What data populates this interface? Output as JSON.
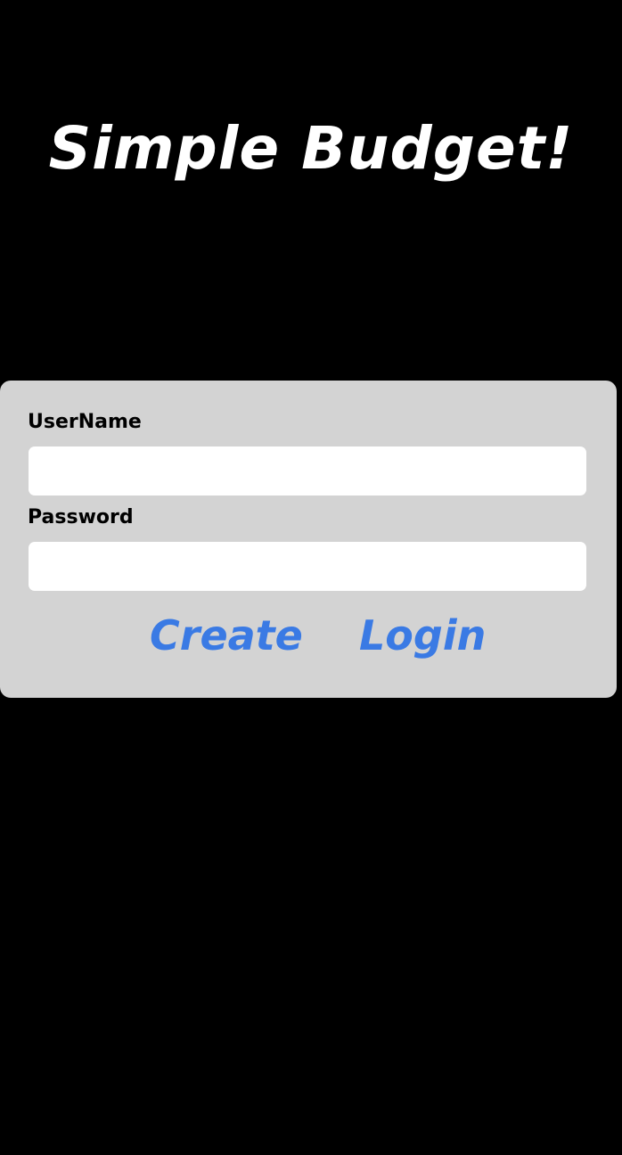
{
  "app": {
    "title": "Simple Budget!"
  },
  "login_form": {
    "username_label": "UserName",
    "username_value": "",
    "password_label": "Password",
    "password_value": "",
    "create_label": "Create",
    "login_label": "Login"
  },
  "colors": {
    "background": "#000000",
    "panel": "#d3d3d3",
    "field": "#ffffff",
    "accent": "#3a7ae4",
    "title": "#ffffff"
  }
}
